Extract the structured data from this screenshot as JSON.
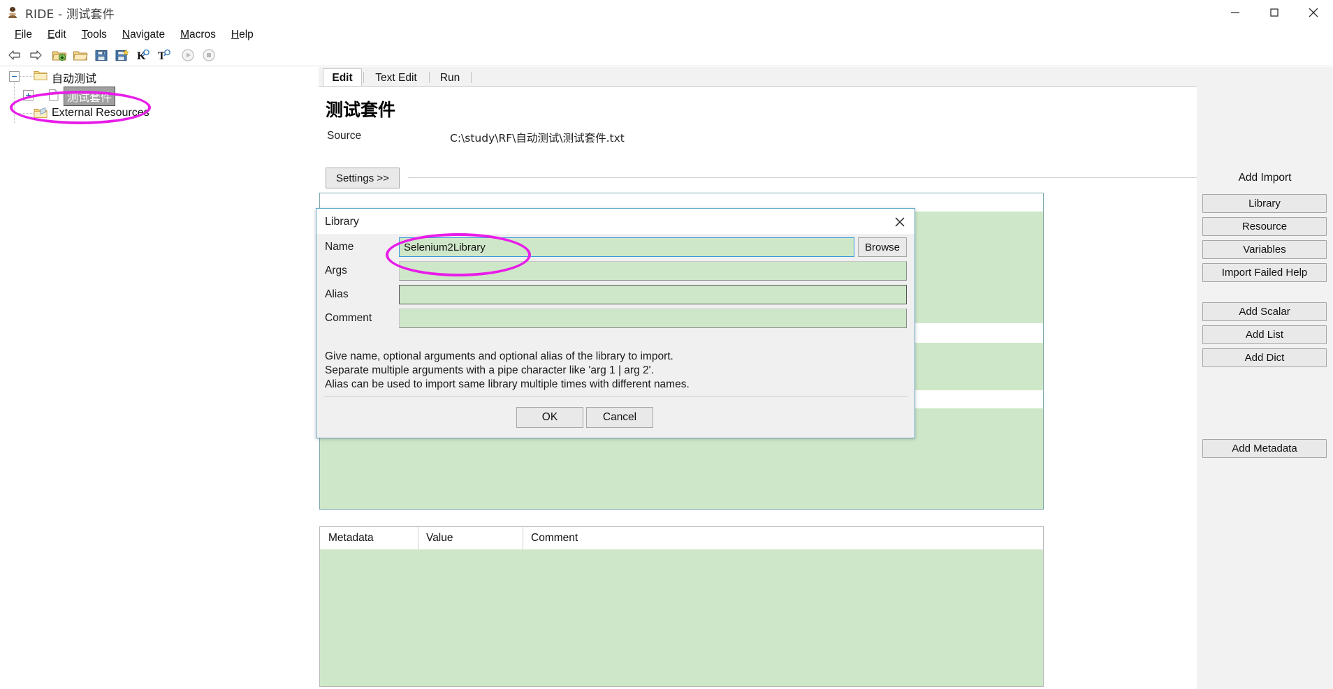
{
  "window": {
    "title": "RIDE - 测试套件",
    "app_icon": "robot-icon",
    "minimize": "minimize-icon",
    "maximize": "maximize-icon",
    "close": "close-icon"
  },
  "menubar": {
    "items": [
      {
        "label": "File",
        "accel": "F"
      },
      {
        "label": "Edit",
        "accel": "E"
      },
      {
        "label": "Tools",
        "accel": "T"
      },
      {
        "label": "Navigate",
        "accel": "N"
      },
      {
        "label": "Macros",
        "accel": "M"
      },
      {
        "label": "Help",
        "accel": "H"
      }
    ]
  },
  "toolbar": {
    "items": [
      {
        "name": "back-arrow-icon",
        "tip": "Back"
      },
      {
        "name": "forward-arrow-icon",
        "tip": "Forward"
      },
      {
        "name": "open-directory-icon",
        "tip": "Open Directory"
      },
      {
        "name": "open-file-icon",
        "tip": "Open"
      },
      {
        "name": "save-icon",
        "tip": "Save"
      },
      {
        "name": "save-all-icon",
        "tip": "Save All"
      },
      {
        "name": "search-keyword-icon",
        "tip": "Search Keywords"
      },
      {
        "name": "search-tests-icon",
        "tip": "Search Tests"
      },
      {
        "name": "run-icon",
        "tip": "Run"
      },
      {
        "name": "stop-icon",
        "tip": "Stop"
      }
    ]
  },
  "tree": {
    "nodes": [
      {
        "label": "自动测试",
        "expander": "−",
        "icon": "folder-icon",
        "selected": false
      },
      {
        "label": "测试套件",
        "expander": "+",
        "icon": "file-icon",
        "selected": true
      },
      {
        "label": "External Resources",
        "expander": "",
        "icon": "resources-folder-icon",
        "selected": false
      }
    ]
  },
  "main": {
    "tabs": [
      {
        "label": "Edit",
        "active": true
      },
      {
        "label": "Text Edit",
        "active": false
      },
      {
        "label": "Run",
        "active": false
      }
    ],
    "tab_nav": {
      "prev": "chevron-left-icon",
      "next": "chevron-right-icon",
      "close": "close-icon"
    },
    "suite_title": "测试套件",
    "source_label": "Source",
    "source_value": "C:\\study\\RF\\自动测试\\测试套件.txt",
    "settings_button": "Settings >>"
  },
  "metadata_table": {
    "columns": [
      "Metadata",
      "Value",
      "Comment"
    ]
  },
  "right_panel": {
    "add_import_label": "Add Import",
    "import_buttons": [
      "Library",
      "Resource",
      "Variables",
      "Import Failed Help"
    ],
    "variable_buttons": [
      "Add Scalar",
      "Add List",
      "Add Dict"
    ],
    "metadata_button": "Add Metadata"
  },
  "dialog": {
    "title": "Library",
    "close_icon": "close-icon",
    "fields": [
      {
        "label": "Name",
        "value": "Selenium2Library",
        "placeholder": "",
        "focused": true
      },
      {
        "label": "Args",
        "value": "",
        "placeholder": "",
        "focused": false
      },
      {
        "label": "Alias",
        "value": "",
        "placeholder": "",
        "focused": false
      },
      {
        "label": "Comment",
        "value": "",
        "placeholder": "",
        "focused": false
      }
    ],
    "browse_button": "Browse",
    "help_lines": [
      "Give name, optional arguments and optional alias of the library to import.",
      "Separate multiple arguments with a pipe character like 'arg 1 | arg 2'.",
      "Alias can be used to import same library multiple times with different names."
    ],
    "ok_button": "OK",
    "cancel_button": "Cancel"
  },
  "annotations": {
    "color": "#e81ce8",
    "ellipses": [
      {
        "name": "tree-node-highlight"
      },
      {
        "name": "name-field-highlight"
      }
    ]
  },
  "colors": {
    "field_green": "#cfe7c9",
    "focus_blue": "#3b9ad9",
    "panel_gray": "#f2f2f2",
    "annotation_magenta": "#e81ce8"
  }
}
